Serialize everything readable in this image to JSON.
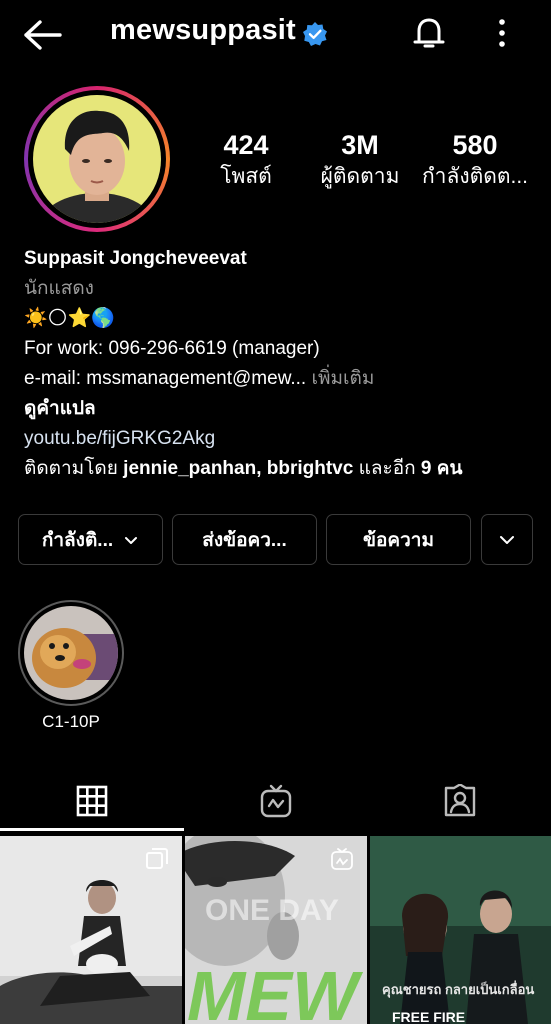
{
  "header": {
    "username": "mewsuppasit",
    "back_icon": "arrow-left-icon",
    "verified_icon": "verified-badge-icon",
    "bell_icon": "bell-icon",
    "more_icon": "more-vertical-icon"
  },
  "stats": [
    {
      "value": "424",
      "label": "โพสต์"
    },
    {
      "value": "3M",
      "label": "ผู้ติดตาม"
    },
    {
      "value": "580",
      "label": "กำลังติดต..."
    }
  ],
  "bio": {
    "full_name": "Suppasit Jongcheveevat",
    "category": "นักแสดง",
    "emojis": "☀️🌕⭐🌎",
    "work": "For work: 096-296-6619 (manager)",
    "email": "e-mail: mssmanagement@mew...",
    "more": "เพิ่มเติม",
    "translate": "ดูคำแปล",
    "link": "youtu.be/fijGRKG2Akg",
    "followed_by_prefix": "ติดตามโดย",
    "followed_by_users": "jennie_panhan, bbrightvc",
    "followed_by_suffix": "และอีก",
    "followed_by_count": "9 คน"
  },
  "buttons": {
    "following": "กำลังติ...",
    "send_message": "ส่งข้อคว...",
    "message": "ข้อความ"
  },
  "highlights": [
    {
      "label": "C1-10P"
    }
  ],
  "tabs": {
    "grid_icon": "grid-icon",
    "igtv_icon": "igtv-icon",
    "tagged_icon": "tagged-person-icon",
    "active": "grid"
  },
  "posts": [
    {
      "name": "post-1",
      "multi": true
    },
    {
      "name": "post-2",
      "overlay_text": "ONE DAY",
      "title": "MEW",
      "igtv": true
    },
    {
      "name": "post-3",
      "overlay_text": "คุณชายรถ กลายเป็นเกลื่อน",
      "bottom_text": "FREE FIRE"
    }
  ],
  "colors": {
    "background": "#000000",
    "verified": "#3897f0",
    "link": "#d7e2f0",
    "muted": "#9a9a9a",
    "button_border": "#3a3a3a"
  }
}
